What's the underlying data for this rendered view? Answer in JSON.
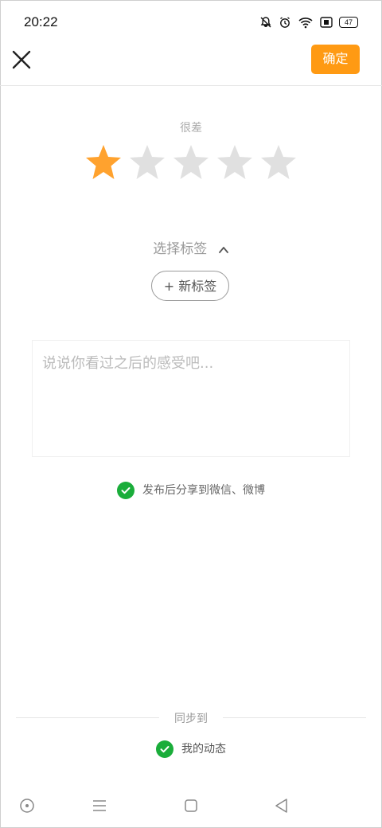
{
  "status_bar": {
    "time": "20:22",
    "battery_level": "47",
    "icons": [
      "mute-bell-icon",
      "alarm-icon",
      "wifi-icon",
      "sim-icon",
      "battery-icon"
    ]
  },
  "header": {
    "confirm_label": "确定",
    "close_icon": "close-icon"
  },
  "rating": {
    "label": "很差",
    "value": 1,
    "max": 5,
    "active_color": "#ffa22e",
    "inactive_color": "#e0e0e0"
  },
  "tags": {
    "select_label": "选择标签",
    "new_tag_label": "+ 新标签"
  },
  "comment": {
    "placeholder": "说说你看过之后的感受吧..."
  },
  "share": {
    "label": "发布后分享到微信、微博",
    "checked": true
  },
  "sync": {
    "label": "同步到",
    "target_label": "我的动态",
    "checked": true
  },
  "colors": {
    "accent": "#ff9a13",
    "check_green": "#1aad3a"
  }
}
